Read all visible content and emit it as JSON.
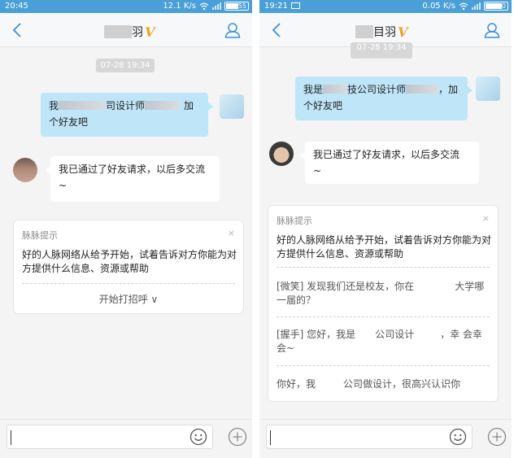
{
  "left": {
    "status": {
      "time": "20:45",
      "speed": "12.1 K/s",
      "battery": "55",
      "battery_level": 0.55
    },
    "title": {
      "visible_text": "羽",
      "badge": "V"
    },
    "timestamp": "07-28 19:34",
    "sent_message": {
      "line1_start": "我",
      "line1_mid": "司设计师",
      "line1_end": "加",
      "line2": "个好友吧"
    },
    "received_message": {
      "line1": "我已通过了好友请求，以后多交流",
      "line2": "~"
    },
    "tip": {
      "header": "脉脉提示",
      "close": "×",
      "body_line1": "好的人脉网络从给予开始，试着告诉对方你能为对",
      "body_line2": "方提供什么信息、资源或帮助",
      "button": "开始打招呼 ∨"
    }
  },
  "right": {
    "status": {
      "time": "19:21",
      "speed": "0.05 K/s",
      "battery": "70",
      "battery_level": 0.7
    },
    "title": {
      "visible_text": "目羽",
      "badge": "V"
    },
    "timestamp": "07-28 19:34",
    "sent_message": {
      "line1_start": "我是",
      "line1_mid": "技公司设计师",
      "line1_end": "，加",
      "line2": "个好友吧"
    },
    "received_message": {
      "line1": "我已通过了好友请求，以后多交流",
      "line2": "~"
    },
    "tip": {
      "header": "脉脉提示",
      "close": "×",
      "body_line1": "好的人脉网络从给予开始，试着告诉对方你能为对",
      "body_line2": "方提供什么信息、资源或帮助",
      "suggestions": [
        {
          "line1_start": "[微笑] 发现我们还是校友，你在",
          "line1_end": "大学哪",
          "line2": "一届的？"
        },
        {
          "line1_start": "[握手] 您好，我是",
          "line1_mid": "公司设计",
          "line1_end": "，幸",
          "line2": "会幸会~"
        },
        {
          "line1_start": "你好，我",
          "line1_end": "公司做设计，很高兴认识你"
        }
      ]
    }
  },
  "icons": {
    "back": "back-chevron-icon",
    "profile": "user-profile-icon",
    "emoji": "emoji-smile-icon",
    "add": "plus-circle-icon",
    "wifi": "wifi-icon",
    "signal": "signal-icon",
    "battery": "battery-icon",
    "message": "message-notification-icon"
  },
  "colors": {
    "status_bar": "#4a9fd8",
    "sent_bubble": "#bfe6f8",
    "accent": "#3a8fd6",
    "v_badge": "#f0a020"
  }
}
